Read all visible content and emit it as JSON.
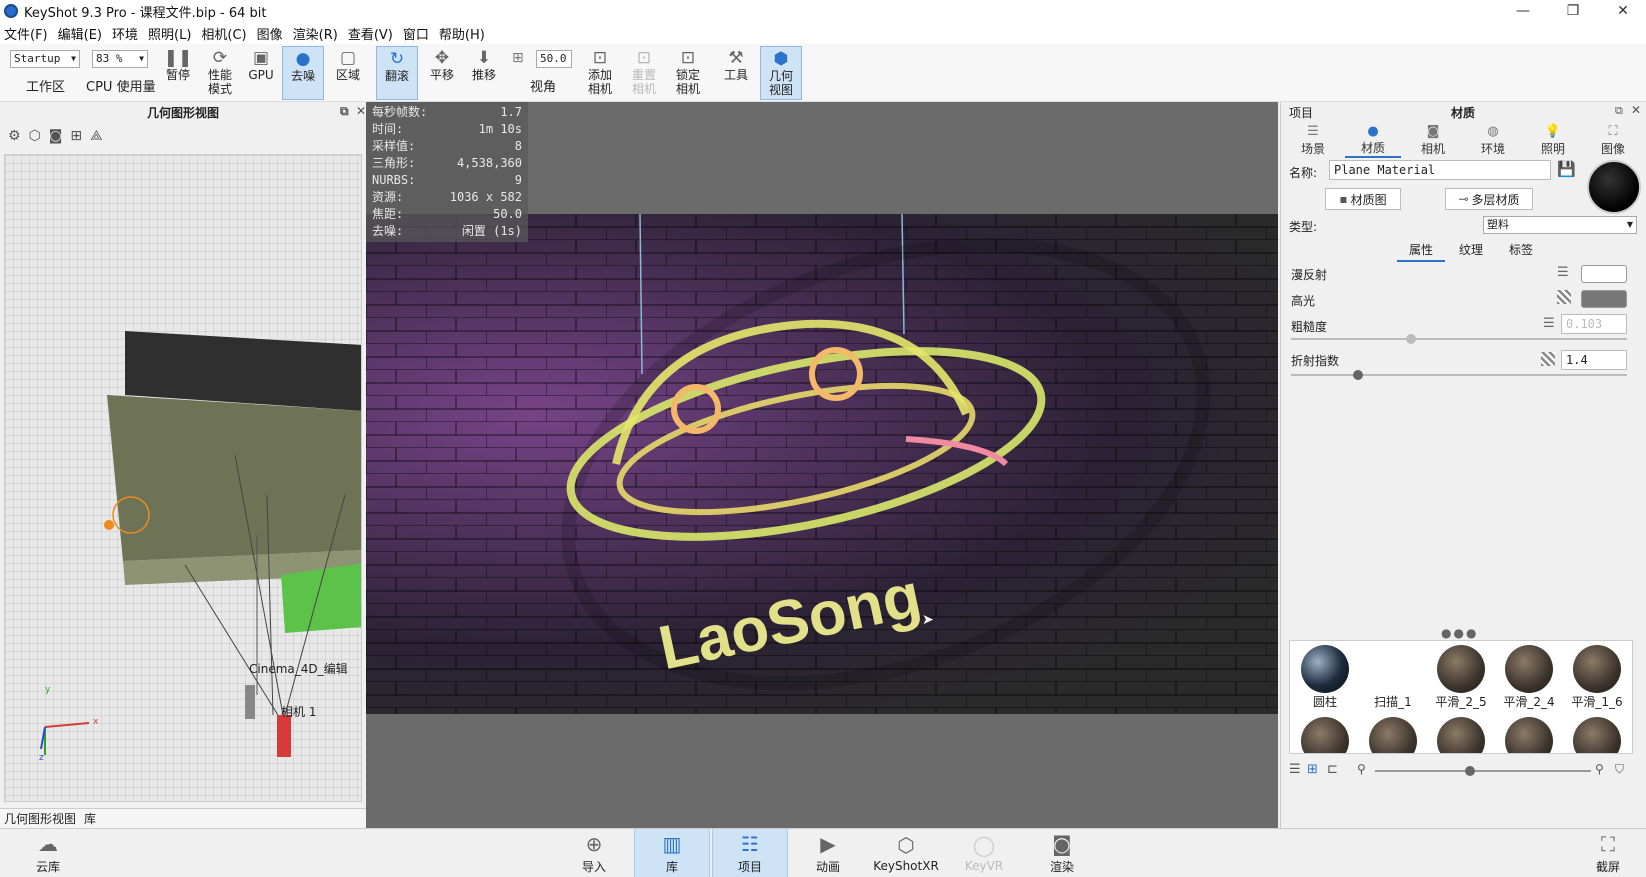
{
  "window": {
    "title": "KeyShot 9.3 Pro  - 课程文件.bip  - 64 bit",
    "minimize": "—",
    "maximize": "❐",
    "close": "✕"
  },
  "menu": [
    "文件(F)",
    "编辑(E)",
    "环境",
    "照明(L)",
    "相机(C)",
    "图像",
    "渲染(R)",
    "查看(V)",
    "窗口",
    "帮助(H)"
  ],
  "toolbar": {
    "workspace_value": "Startup",
    "workspace_label": "工作区",
    "cpu_value": "83 %",
    "cpu_label": "CPU 使用量",
    "pause": "暂停",
    "perf_mode": "性能\n模式",
    "gpu": "GPU",
    "denoise": "去噪",
    "region": "区域",
    "tumble": "翻滚",
    "pan": "平移",
    "dolly": "推移",
    "fov_value": "50.0",
    "fov_label": "视角",
    "add_camera": "添加\n相机",
    "reset_camera": "重置\n相机",
    "lock_camera": "锁定\n相机",
    "tools": "工具",
    "geometry_view": "几何\n视图"
  },
  "left_panel": {
    "title": "几何图形视图",
    "camera_label_1": "Cinema_4D_编辑",
    "camera_label_2": "相机 1",
    "axis_x": "x",
    "axis_y": "y",
    "axis_z": "z",
    "tabs": [
      "几何图形视图",
      "库"
    ]
  },
  "stats": [
    {
      "k": "每秒帧数:",
      "v": "1.7"
    },
    {
      "k": "时间:",
      "v": "1m 10s"
    },
    {
      "k": "采样值:",
      "v": "8"
    },
    {
      "k": "三角形:",
      "v": "4,538,360"
    },
    {
      "k": "NURBS:",
      "v": "9"
    },
    {
      "k": "资源:",
      "v": "1036 x 582"
    },
    {
      "k": "焦距:",
      "v": "50.0"
    },
    {
      "k": "去噪:",
      "v": "闲置 (1s)"
    }
  ],
  "render": {
    "sign_text": "LaoSong"
  },
  "right_panel": {
    "header_left": "项目",
    "header_title": "材质",
    "tabs": [
      "场景",
      "材质",
      "相机",
      "环境",
      "照明",
      "图像"
    ],
    "name_label": "名称:",
    "name_value": "Plane Material",
    "material_graph": "材质图",
    "multi_material": "多层材质",
    "type_label": "类型:",
    "type_value": "塑料",
    "subtabs": [
      "属性",
      "纹理",
      "标签"
    ],
    "props": {
      "diffuse": "漫反射",
      "specular": "高光",
      "roughness": "粗糙度",
      "roughness_value": "0.103",
      "roughness_fraction": 0.103,
      "ior": "折射指数",
      "ior_value": "1.4"
    },
    "materials": [
      "圆柱",
      "扫描_1",
      "平滑_2_5",
      "平滑_2_4",
      "平滑_1_6"
    ]
  },
  "bottom": {
    "cloud": "云库",
    "import": "导入",
    "library": "库",
    "project": "项目",
    "animation": "动画",
    "keyshotxr": "KeyShotXR",
    "keyvr": "KeyVR",
    "render": "渲染",
    "screenshot": "截屏"
  },
  "colors": {
    "accent": "#2a73c9",
    "active_bg": "#cfe3f7"
  }
}
